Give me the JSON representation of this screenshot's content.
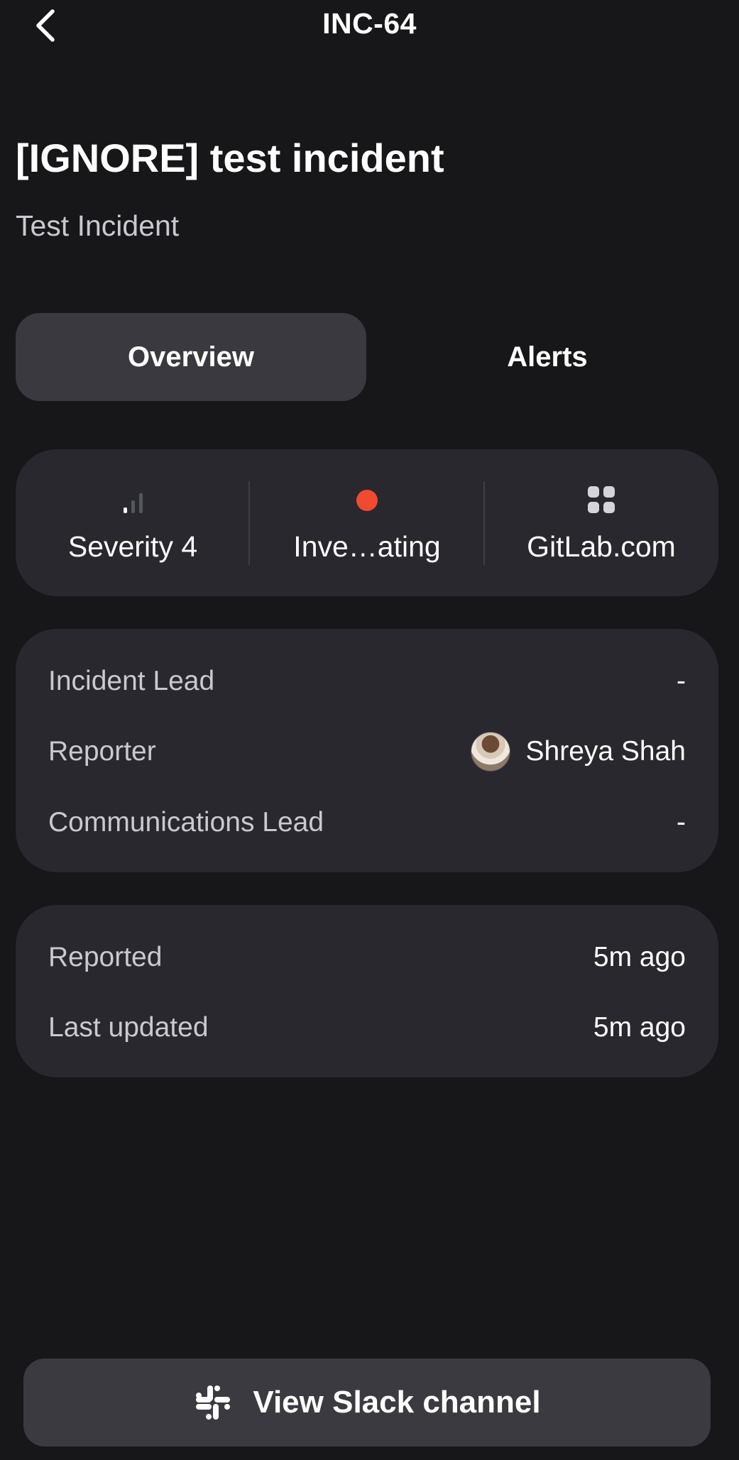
{
  "header": {
    "back_icon": "chevron-left-icon",
    "title": "INC-64"
  },
  "incident": {
    "title": "[IGNORE] test incident",
    "subtitle": "Test Incident"
  },
  "tabs": [
    {
      "label": "Overview",
      "active": true
    },
    {
      "label": "Alerts",
      "active": false
    }
  ],
  "summary": {
    "severity": {
      "icon": "signal-bars-icon",
      "label": "Severity 4",
      "bars_filled": 1,
      "bars_total": 3
    },
    "status": {
      "icon": "status-dot-icon",
      "label": "Inve…ating",
      "color": "#f04a2f"
    },
    "group": {
      "icon": "grid-icon",
      "label": "GitLab.com"
    }
  },
  "roles": [
    {
      "key": "Incident Lead",
      "value": "-"
    },
    {
      "key": "Reporter",
      "value": "Shreya Shah",
      "avatar": true
    },
    {
      "key": "Communications Lead",
      "value": "-"
    }
  ],
  "times": [
    {
      "key": "Reported",
      "value": "5m ago"
    },
    {
      "key": "Last updated",
      "value": "5m ago"
    }
  ],
  "footer": {
    "slack_icon": "slack-icon",
    "button_label": "View Slack channel"
  },
  "colors": {
    "background": "#171719",
    "card": "#28282e",
    "active_tab": "#39393f",
    "button": "#3a3a40",
    "status_red": "#f04a2f"
  }
}
